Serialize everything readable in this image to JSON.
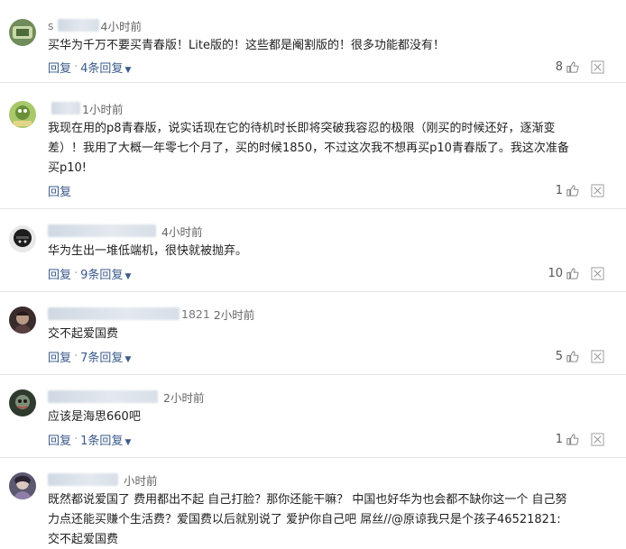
{
  "reply_label": "回复",
  "separator": "·",
  "comments": [
    {
      "name_tail": "s",
      "time": "4小时前",
      "lines": [
        "买华为千万不要买青春版！Lite版的！这些都是阉割版的！很多功能都没有！"
      ],
      "replies": "4条回复",
      "likes": "8"
    },
    {
      "name_tail": "",
      "time": "1小时前",
      "lines": [
        "我现在用的p8青春版，说实话现在它的待机时长即将突破我容忍的极限（刚买的时候还好，逐渐变",
        "差）！我用了大概一年零七个月了，买的时候1850，不过这次我不想再买p10青春版了。我这次准备",
        "买p10!"
      ],
      "replies": "",
      "likes": "1"
    },
    {
      "name_tail": "",
      "time": "4小时前",
      "lines": [
        "华为生出一堆低端机，很快就被抛弃。"
      ],
      "replies": "9条回复",
      "likes": "10"
    },
    {
      "name_tail": "1821",
      "time": "2小时前",
      "lines": [
        "交不起爱国费"
      ],
      "replies": "7条回复",
      "likes": "5"
    },
    {
      "name_tail": "",
      "time": "2小时前",
      "lines": [
        "应该是海思660吧"
      ],
      "replies": "1条回复",
      "likes": "1"
    },
    {
      "name_tail": "",
      "time": "小时前",
      "lines": [
        "既然都说爱国了 费用都出不起 自己打脸？那你还能干嘛？ 中国也好华为也会都不缺你这一个 自己努",
        "力点还能买赚个生活费？爱国费以后就别说了 爱护你自己吧 屌丝//@原谅我只是个孩子46521821:",
        "交不起爱国费"
      ],
      "replies": "",
      "likes": ""
    }
  ]
}
